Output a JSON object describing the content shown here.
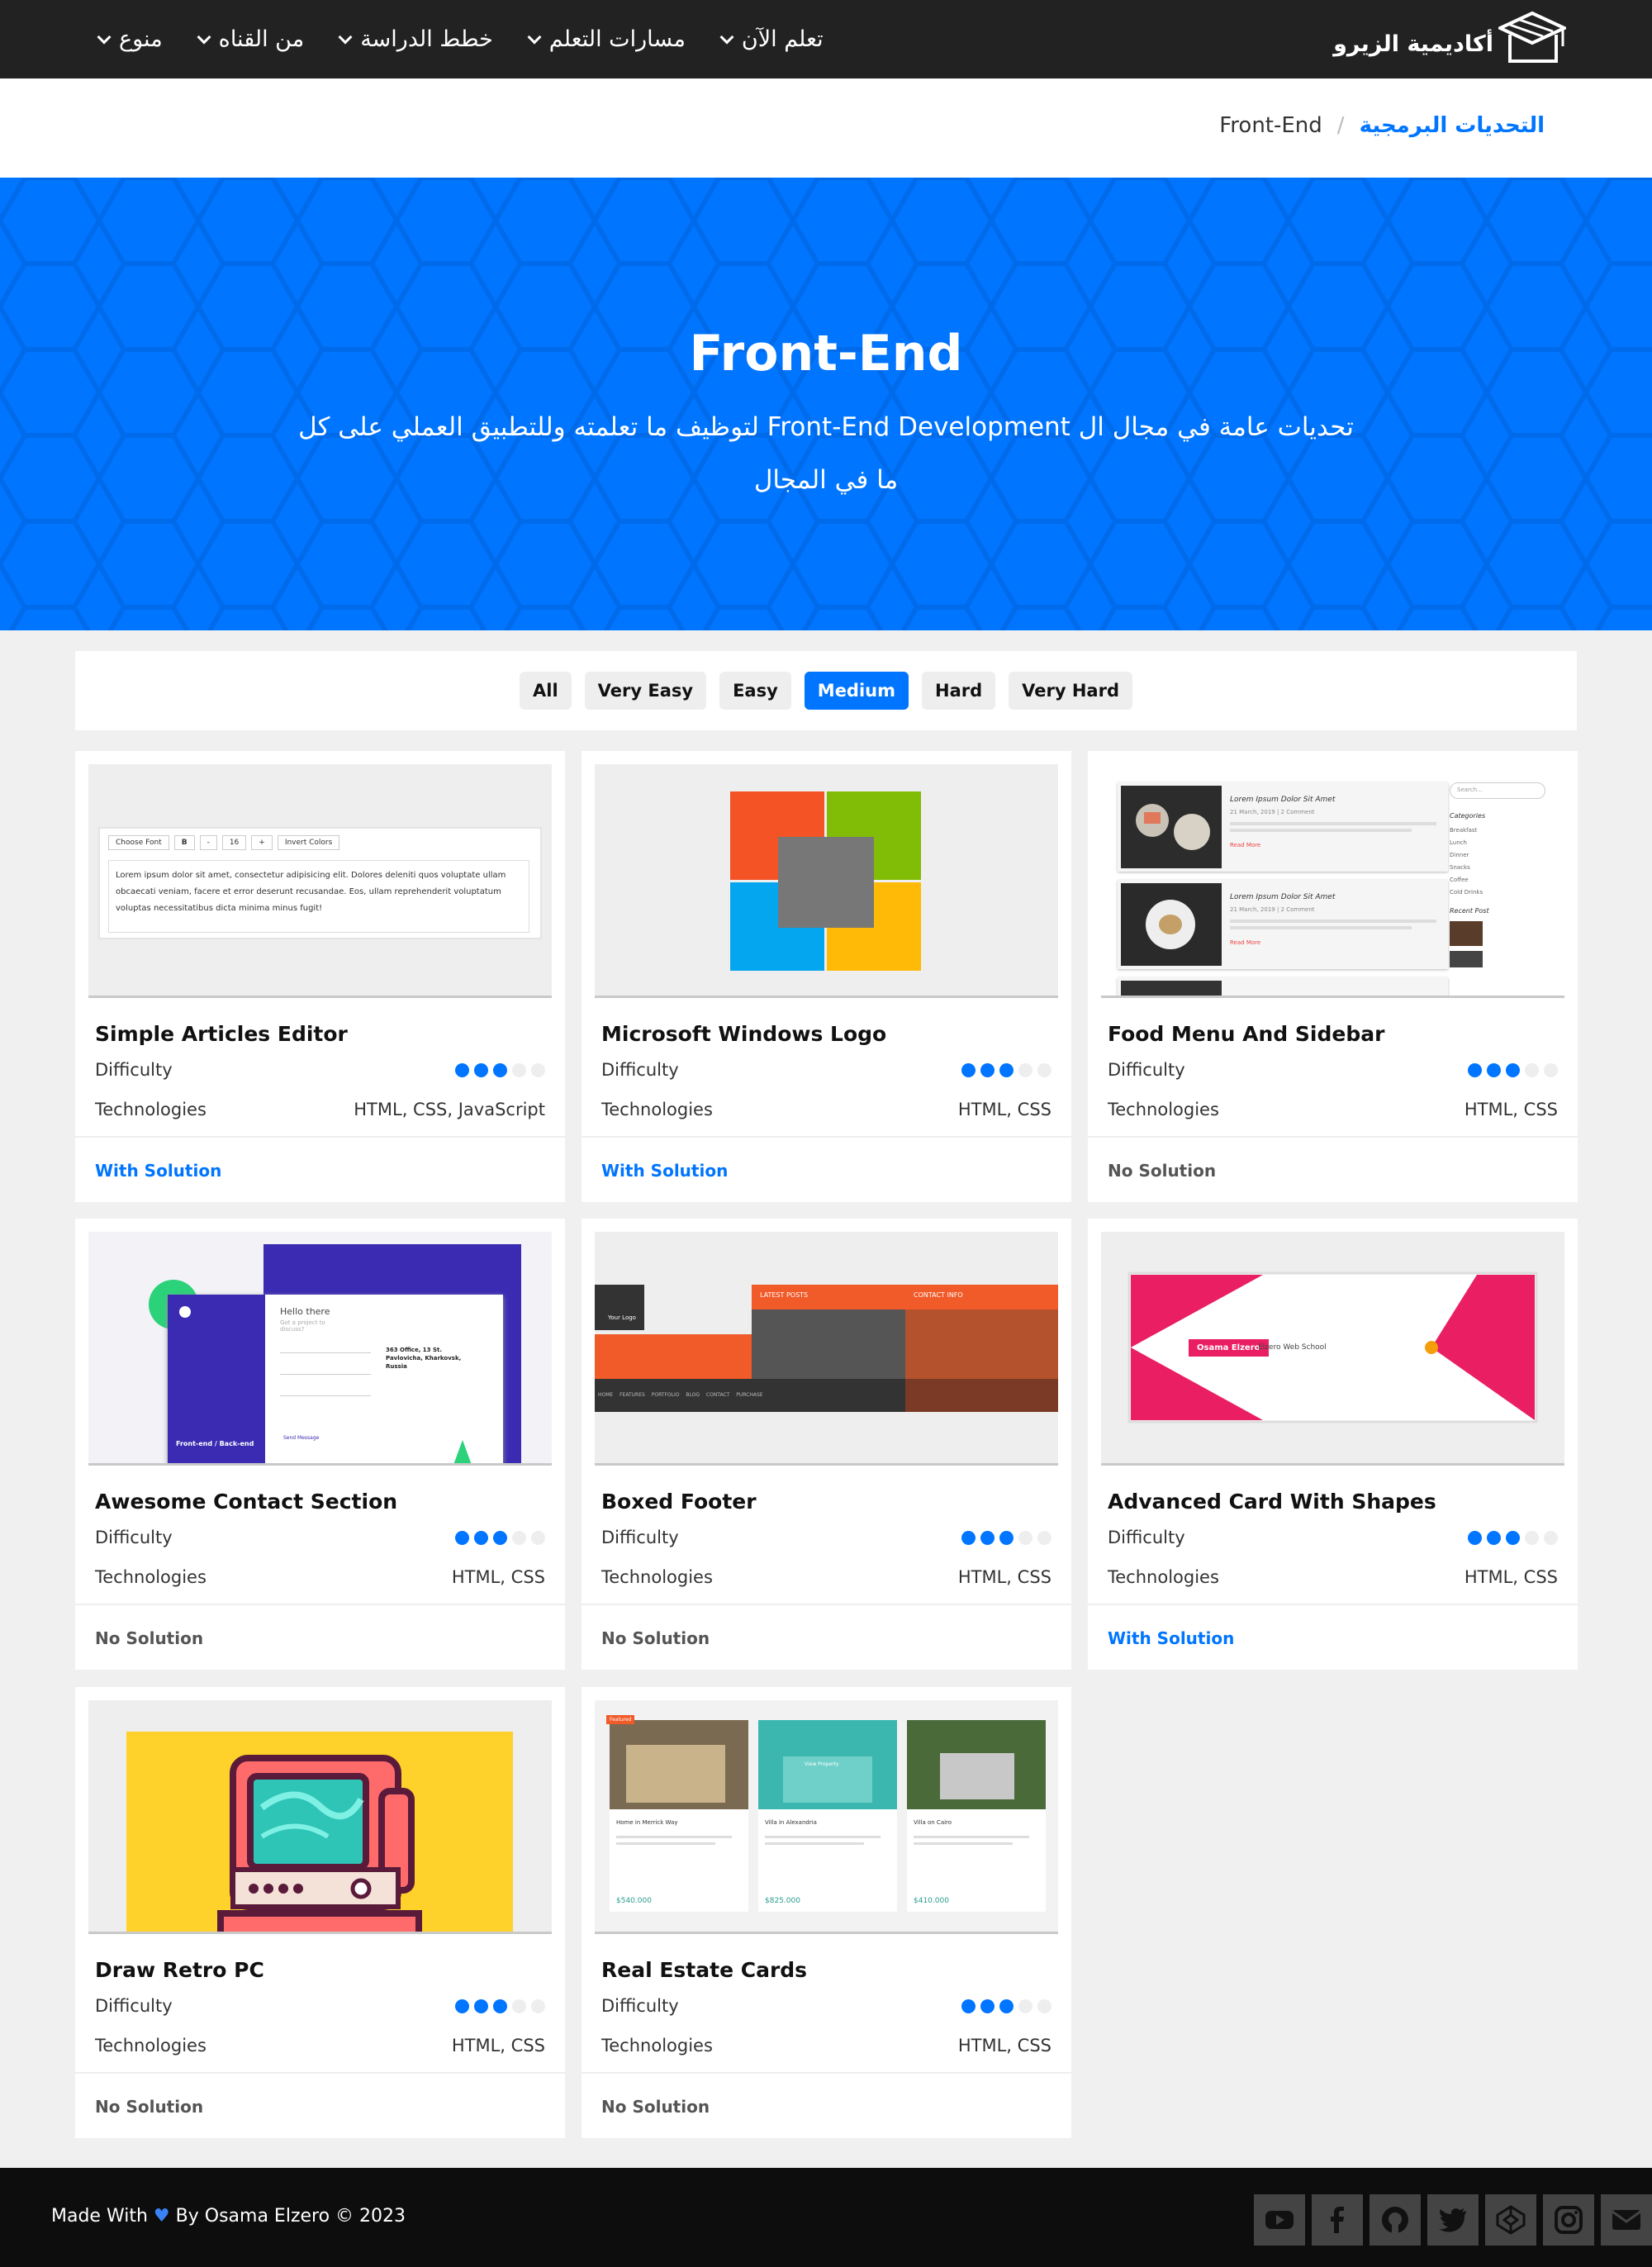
{
  "nav": {
    "logo_text": "أكاديمية الزيرو",
    "items": [
      {
        "label": "تعلم الآن"
      },
      {
        "label": "مسارات التعلم"
      },
      {
        "label": "خطط الدراسة"
      },
      {
        "label": "من القناه"
      },
      {
        "label": "منوع"
      }
    ]
  },
  "breadcrumb": {
    "parent": "التحديات البرمجية",
    "separator": "/",
    "current": "Front-End"
  },
  "hero": {
    "title": "Front-End",
    "subtitle": "تحديات عامة في مجال ال Front-End Development لتوظيف ما تعلمته وللتطبيق العملي على كل ما في المجال"
  },
  "filters": {
    "items": [
      "All",
      "Very Easy",
      "Easy",
      "Medium",
      "Hard",
      "Very Hard"
    ],
    "active": "Medium"
  },
  "labels": {
    "difficulty": "Difficulty",
    "technologies": "Technologies"
  },
  "cards": [
    {
      "title": "Simple Articles Editor",
      "difficulty": 3,
      "max": 5,
      "tech": "HTML, CSS, JavaScript",
      "solution": "With Solution",
      "has_solution": true
    },
    {
      "title": "Microsoft Windows Logo",
      "difficulty": 3,
      "max": 5,
      "tech": "HTML, CSS",
      "solution": "With Solution",
      "has_solution": true
    },
    {
      "title": "Food Menu And Sidebar",
      "difficulty": 3,
      "max": 5,
      "tech": "HTML, CSS",
      "solution": "No Solution",
      "has_solution": false
    },
    {
      "title": "Awesome Contact Section",
      "difficulty": 3,
      "max": 5,
      "tech": "HTML, CSS",
      "solution": "No Solution",
      "has_solution": false
    },
    {
      "title": "Boxed Footer",
      "difficulty": 3,
      "max": 5,
      "tech": "HTML, CSS",
      "solution": "No Solution",
      "has_solution": false
    },
    {
      "title": "Advanced Card With Shapes",
      "difficulty": 3,
      "max": 5,
      "tech": "HTML, CSS",
      "solution": "With Solution",
      "has_solution": true
    },
    {
      "title": "Draw Retro PC",
      "difficulty": 3,
      "max": 5,
      "tech": "HTML, CSS",
      "solution": "No Solution",
      "has_solution": false
    },
    {
      "title": "Real Estate Cards",
      "difficulty": 3,
      "max": 5,
      "tech": "HTML, CSS",
      "solution": "No Solution",
      "has_solution": false
    }
  ],
  "thumbs": {
    "editor": {
      "font_select": "Choose Font",
      "bold": "B",
      "minus": "-",
      "size": "16",
      "plus": "+",
      "invert": "Invert Colors",
      "text": "Lorem ipsum dolor sit amet, consectetur adipisicing elit. Dolores deleniti quos voluptate ullam obcaecati veniam, facere et error deserunt recusandae. Eos, ullam reprehenderit voluptatum voluptas necessitatibus dicta minima minus fugit!"
    },
    "food": {
      "post_title": "Lorem Ipsum Dolor Sit Amet",
      "post_meta": "21 March, 2019 | 2 Comment",
      "read_more": "Read More",
      "search": "Search...",
      "categories_title": "Categories",
      "categories": [
        "Breakfast",
        "Lunch",
        "Dinner",
        "Snacks",
        "Coffee",
        "Cold Drinks"
      ],
      "recent_title": "Recent Post"
    },
    "contact": {
      "hello": "Hello there",
      "sub": "Got a project to discuss?",
      "badge": "Front-end / Back-end",
      "address": "363 Office, 13 St. Pavlovicha, Kharkovsk, Russia",
      "send": "Send Message"
    },
    "boxed_footer": {
      "logo": "Your Logo",
      "latest": "LATEST POSTS",
      "contact": "CONTACT INFO",
      "menu": "HOME  FEATURES  PORTFOLIO  BLOG  CONTACT  PURCHASE"
    },
    "shape_card": {
      "name": "Osama Elzero",
      "school": "Elzero Web School"
    },
    "real_estate": {
      "tag": "Featured",
      "houses": [
        {
          "name": "Home in Merrick Way",
          "price": "$540.000"
        },
        {
          "name": "Villa in Alexandria",
          "price": "$825.000"
        },
        {
          "name": "Villa on Cairo",
          "price": "$410.000"
        }
      ],
      "view": "View Property"
    }
  },
  "footer": {
    "made_with": "Made With",
    "heart": "♥",
    "by": "By Osama Elzero © 2023",
    "socials": [
      "youtube-icon",
      "facebook-icon",
      "github-icon",
      "twitter-icon",
      "codepen-icon",
      "instagram-icon",
      "email-icon"
    ]
  },
  "colors": {
    "accent": "#0075ff",
    "nav_bg": "#222222",
    "footer_bg": "#0d0d0d"
  }
}
